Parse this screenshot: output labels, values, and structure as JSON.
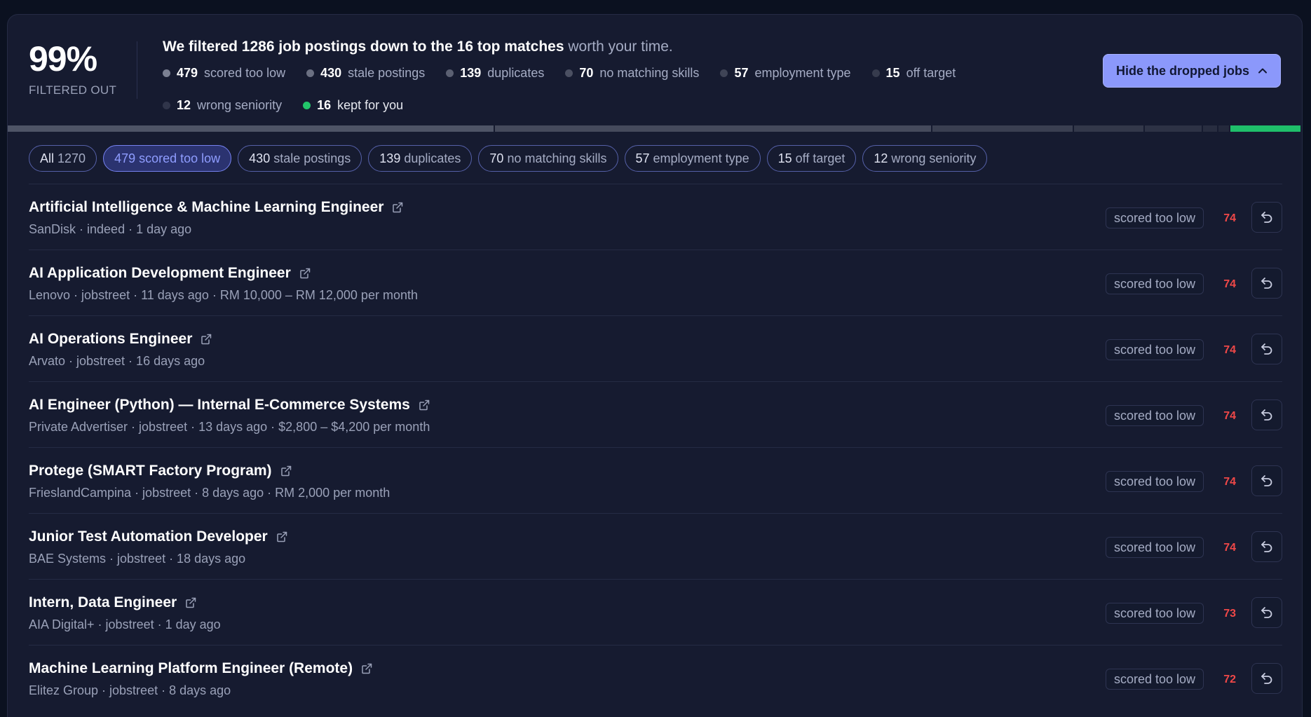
{
  "summary": {
    "percent": "99%",
    "percent_label": "FILTERED OUT",
    "headline_strong": "We filtered 1286 job postings down to the 16 top matches",
    "headline_soft": "worth your time.",
    "stats": [
      {
        "num": "479",
        "label": "scored too low",
        "color": "#7b8092"
      },
      {
        "num": "430",
        "label": "stale postings",
        "color": "#6b7082"
      },
      {
        "num": "139",
        "label": "duplicates",
        "color": "#5b6072"
      },
      {
        "num": "70",
        "label": "no matching skills",
        "color": "#4b5062"
      },
      {
        "num": "57",
        "label": "employment type",
        "color": "#3f4456"
      },
      {
        "num": "15",
        "label": "off target",
        "color": "#363b4d"
      },
      {
        "num": "12",
        "label": "wrong seniority",
        "color": "#30354a"
      },
      {
        "num": "16",
        "label": "kept for you",
        "color": "#22c56a"
      }
    ],
    "hide_button_label": "Hide the dropped jobs"
  },
  "progress_segments": [
    {
      "value": 479,
      "color": "#4e5466"
    },
    {
      "value": 430,
      "color": "#454a5c"
    },
    {
      "value": 139,
      "color": "#3a3f51"
    },
    {
      "value": 70,
      "color": "#33384a"
    },
    {
      "value": 57,
      "color": "#2d3245"
    },
    {
      "value": 15,
      "color": "#282d40"
    },
    {
      "value": 12,
      "color": "#24293c"
    },
    {
      "value": 70,
      "color": "#1fbf6a"
    }
  ],
  "chips": [
    {
      "num": "All",
      "label": "1270",
      "active": false
    },
    {
      "num": "479",
      "label": "scored too low",
      "active": true
    },
    {
      "num": "430",
      "label": "stale postings",
      "active": false
    },
    {
      "num": "139",
      "label": "duplicates",
      "active": false
    },
    {
      "num": "70",
      "label": "no matching skills",
      "active": false
    },
    {
      "num": "57",
      "label": "employment type",
      "active": false
    },
    {
      "num": "15",
      "label": "off target",
      "active": false
    },
    {
      "num": "12",
      "label": "wrong seniority",
      "active": false
    }
  ],
  "jobs": [
    {
      "title": "Artificial Intelligence & Machine Learning Engineer",
      "meta": "SanDisk · indeed · 1 day ago",
      "tag": "scored too low",
      "score": "74"
    },
    {
      "title": "AI Application Development Engineer",
      "meta": "Lenovo · jobstreet · 11 days ago · RM 10,000 – RM 12,000 per month",
      "tag": "scored too low",
      "score": "74"
    },
    {
      "title": "AI Operations Engineer",
      "meta": "Arvato · jobstreet · 16 days ago",
      "tag": "scored too low",
      "score": "74"
    },
    {
      "title": "AI Engineer (Python) — Internal E-Commerce Systems",
      "meta": "Private Advertiser · jobstreet · 13 days ago · $2,800 – $4,200 per month",
      "tag": "scored too low",
      "score": "74"
    },
    {
      "title": "Protege (SMART Factory Program)",
      "meta": "FrieslandCampina · jobstreet · 8 days ago · RM 2,000 per month",
      "tag": "scored too low",
      "score": "74"
    },
    {
      "title": "Junior Test Automation Developer",
      "meta": "BAE Systems · jobstreet · 18 days ago",
      "tag": "scored too low",
      "score": "74"
    },
    {
      "title": "Intern, Data Engineer",
      "meta": "AIA Digital+ · jobstreet · 1 day ago",
      "tag": "scored too low",
      "score": "73"
    },
    {
      "title": "Machine Learning Platform Engineer (Remote)",
      "meta": "Elitez Group · jobstreet · 8 days ago",
      "tag": "scored too low",
      "score": "72"
    }
  ],
  "icons": {
    "external": "external-link-icon",
    "restore": "undo-icon",
    "chevron": "chevron-up-icon"
  }
}
